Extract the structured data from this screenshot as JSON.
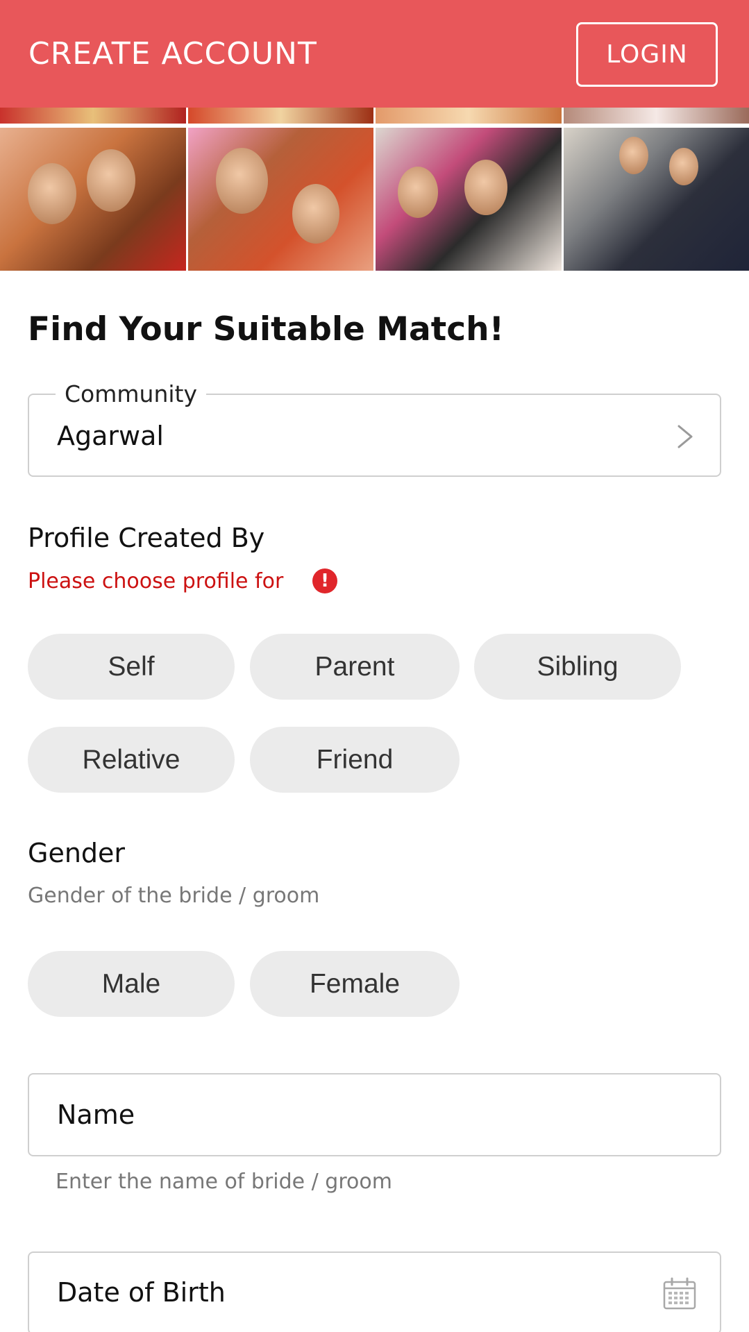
{
  "header": {
    "title": "CREATE ACCOUNT",
    "login_label": "LOGIN",
    "background_color": "#e8575a"
  },
  "main": {
    "heading": "Find Your Suitable Match!",
    "community": {
      "label": "Community",
      "value": "Agarwal",
      "icon": "chevron-right-icon"
    },
    "profile_created_by": {
      "label": "Profile Created By",
      "error": "Please choose profile for",
      "error_icon": "exclamation-icon",
      "error_color": "#cc1111",
      "options": [
        "Self",
        "Parent",
        "Sibling",
        "Relative",
        "Friend"
      ]
    },
    "gender": {
      "label": "Gender",
      "hint": "Gender of the bride / groom",
      "options": [
        "Male",
        "Female"
      ]
    },
    "name": {
      "label": "Name",
      "hint": "Enter the name of bride / groom"
    },
    "dob": {
      "label": "Date of Birth",
      "icon": "calendar-icon"
    }
  }
}
